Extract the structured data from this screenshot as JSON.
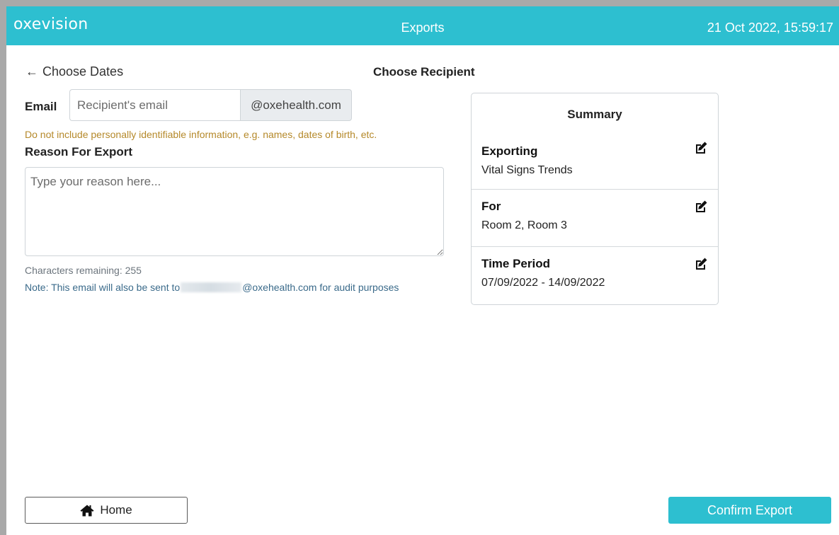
{
  "header": {
    "logo": "oxevision",
    "title": "Exports",
    "datetime": "21 Oct 2022, 15:59:17"
  },
  "nav": {
    "back_label": "Choose Dates",
    "step_title": "Choose Recipient"
  },
  "form": {
    "email_label": "Email",
    "email_placeholder": "Recipient's email",
    "email_value": "",
    "email_suffix": "@oxehealth.com",
    "pii_warning": "Do not include personally identifiable information, e.g. names, dates of birth, etc.",
    "reason_label": "Reason For Export",
    "reason_placeholder": "Type your reason here...",
    "reason_value": "",
    "chars_remaining": "Characters remaining: 255",
    "audit_note_prefix": "Note: This email will also be sent to",
    "audit_note_suffix": "@oxehealth.com for audit purposes"
  },
  "summary": {
    "title": "Summary",
    "items": [
      {
        "heading": "Exporting",
        "value": "Vital Signs Trends"
      },
      {
        "heading": "For",
        "value": "Room 2, Room 3"
      },
      {
        "heading": "Time Period",
        "value": "07/09/2022 - 14/09/2022"
      }
    ]
  },
  "footer": {
    "home_label": "Home",
    "confirm_label": "Confirm Export"
  },
  "colors": {
    "brand": "#2dbfd0",
    "warning_text": "#b5892a",
    "note_text": "#3a6a8a"
  },
  "icons": [
    "arrow-left-icon",
    "edit-icon",
    "home-icon"
  ]
}
